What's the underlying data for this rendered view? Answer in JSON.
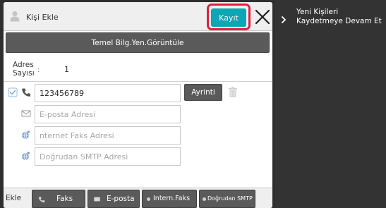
{
  "header": {
    "title": "Kişi Ekle",
    "save_label": "Kayıt"
  },
  "toolbar": {
    "show_basic_label": "Temel Bilg.Yen.Görüntüle"
  },
  "address_count": {
    "label": "Adres Sayısı",
    "separator": ":",
    "value": "1"
  },
  "entries": {
    "phone_value": "123456789",
    "detail_label": "Ayrinti",
    "email_placeholder": "E-posta Adresi",
    "ifax_placeholder": "nternet Faks Adresi",
    "smtp_placeholder": "Doğrudan SMTP Adresi"
  },
  "bottom": {
    "add_label": "Ekle",
    "tabs": [
      "Faks",
      "E-posta",
      "Intern.Faks",
      "Doğrudan SMTP"
    ]
  },
  "side": {
    "continue_text": "Yeni Kişileri Kaydetmeye Devam Et"
  },
  "colors": {
    "accent": "#0ea5b4",
    "highlight": "#e02040",
    "dark_button": "#5a5a5a"
  }
}
